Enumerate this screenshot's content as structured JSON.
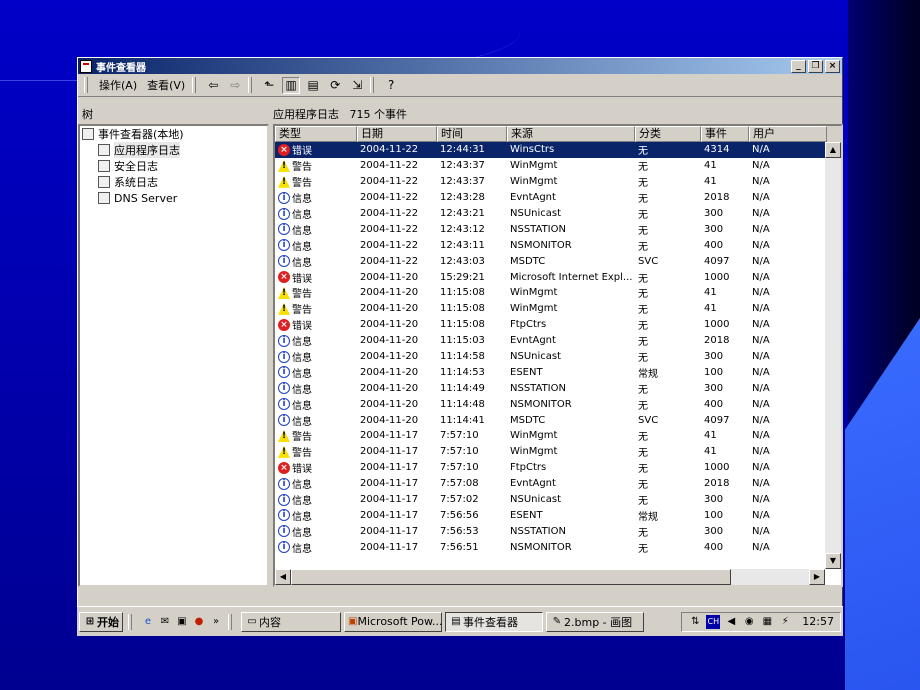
{
  "window": {
    "title": "事件查看器"
  },
  "menu": {
    "action": "操作(A)",
    "view": "查看(V)"
  },
  "tree": {
    "header": "树",
    "root": "事件查看器(本地)",
    "items": [
      "应用程序日志",
      "安全日志",
      "系统日志",
      "DNS Server"
    ]
  },
  "list": {
    "title": "应用程序日志",
    "count": "715 个事件",
    "columns": [
      "类型",
      "日期",
      "时间",
      "来源",
      "分类",
      "事件",
      "用户"
    ],
    "rows": [
      {
        "type": "错误",
        "level": "error",
        "date": "2004-11-22",
        "time": "12:44:31",
        "source": "WinsCtrs",
        "category": "无",
        "event": "4314",
        "user": "N/A"
      },
      {
        "type": "警告",
        "level": "warning",
        "date": "2004-11-22",
        "time": "12:43:37",
        "source": "WinMgmt",
        "category": "无",
        "event": "41",
        "user": "N/A"
      },
      {
        "type": "警告",
        "level": "warning",
        "date": "2004-11-22",
        "time": "12:43:37",
        "source": "WinMgmt",
        "category": "无",
        "event": "41",
        "user": "N/A"
      },
      {
        "type": "信息",
        "level": "info",
        "date": "2004-11-22",
        "time": "12:43:28",
        "source": "EvntAgnt",
        "category": "无",
        "event": "2018",
        "user": "N/A"
      },
      {
        "type": "信息",
        "level": "info",
        "date": "2004-11-22",
        "time": "12:43:21",
        "source": "NSUnicast",
        "category": "无",
        "event": "300",
        "user": "N/A"
      },
      {
        "type": "信息",
        "level": "info",
        "date": "2004-11-22",
        "time": "12:43:12",
        "source": "NSSTATION",
        "category": "无",
        "event": "300",
        "user": "N/A"
      },
      {
        "type": "信息",
        "level": "info",
        "date": "2004-11-22",
        "time": "12:43:11",
        "source": "NSMONITOR",
        "category": "无",
        "event": "400",
        "user": "N/A"
      },
      {
        "type": "信息",
        "level": "info",
        "date": "2004-11-22",
        "time": "12:43:03",
        "source": "MSDTC",
        "category": "SVC",
        "event": "4097",
        "user": "N/A"
      },
      {
        "type": "错误",
        "level": "error",
        "date": "2004-11-20",
        "time": "15:29:21",
        "source": "Microsoft Internet Expl...",
        "category": "无",
        "event": "1000",
        "user": "N/A"
      },
      {
        "type": "警告",
        "level": "warning",
        "date": "2004-11-20",
        "time": "11:15:08",
        "source": "WinMgmt",
        "category": "无",
        "event": "41",
        "user": "N/A"
      },
      {
        "type": "警告",
        "level": "warning",
        "date": "2004-11-20",
        "time": "11:15:08",
        "source": "WinMgmt",
        "category": "无",
        "event": "41",
        "user": "N/A"
      },
      {
        "type": "错误",
        "level": "error",
        "date": "2004-11-20",
        "time": "11:15:08",
        "source": "FtpCtrs",
        "category": "无",
        "event": "1000",
        "user": "N/A"
      },
      {
        "type": "信息",
        "level": "info",
        "date": "2004-11-20",
        "time": "11:15:03",
        "source": "EvntAgnt",
        "category": "无",
        "event": "2018",
        "user": "N/A"
      },
      {
        "type": "信息",
        "level": "info",
        "date": "2004-11-20",
        "time": "11:14:58",
        "source": "NSUnicast",
        "category": "无",
        "event": "300",
        "user": "N/A"
      },
      {
        "type": "信息",
        "level": "info",
        "date": "2004-11-20",
        "time": "11:14:53",
        "source": "ESENT",
        "category": "常规",
        "event": "100",
        "user": "N/A"
      },
      {
        "type": "信息",
        "level": "info",
        "date": "2004-11-20",
        "time": "11:14:49",
        "source": "NSSTATION",
        "category": "无",
        "event": "300",
        "user": "N/A"
      },
      {
        "type": "信息",
        "level": "info",
        "date": "2004-11-20",
        "time": "11:14:48",
        "source": "NSMONITOR",
        "category": "无",
        "event": "400",
        "user": "N/A"
      },
      {
        "type": "信息",
        "level": "info",
        "date": "2004-11-20",
        "time": "11:14:41",
        "source": "MSDTC",
        "category": "SVC",
        "event": "4097",
        "user": "N/A"
      },
      {
        "type": "警告",
        "level": "warning",
        "date": "2004-11-17",
        "time": "7:57:10",
        "source": "WinMgmt",
        "category": "无",
        "event": "41",
        "user": "N/A"
      },
      {
        "type": "警告",
        "level": "warning",
        "date": "2004-11-17",
        "time": "7:57:10",
        "source": "WinMgmt",
        "category": "无",
        "event": "41",
        "user": "N/A"
      },
      {
        "type": "错误",
        "level": "error",
        "date": "2004-11-17",
        "time": "7:57:10",
        "source": "FtpCtrs",
        "category": "无",
        "event": "1000",
        "user": "N/A"
      },
      {
        "type": "信息",
        "level": "info",
        "date": "2004-11-17",
        "time": "7:57:08",
        "source": "EvntAgnt",
        "category": "无",
        "event": "2018",
        "user": "N/A"
      },
      {
        "type": "信息",
        "level": "info",
        "date": "2004-11-17",
        "time": "7:57:02",
        "source": "NSUnicast",
        "category": "无",
        "event": "300",
        "user": "N/A"
      },
      {
        "type": "信息",
        "level": "info",
        "date": "2004-11-17",
        "time": "7:56:56",
        "source": "ESENT",
        "category": "常规",
        "event": "100",
        "user": "N/A"
      },
      {
        "type": "信息",
        "level": "info",
        "date": "2004-11-17",
        "time": "7:56:53",
        "source": "NSSTATION",
        "category": "无",
        "event": "300",
        "user": "N/A"
      },
      {
        "type": "信息",
        "level": "info",
        "date": "2004-11-17",
        "time": "7:56:51",
        "source": "NSMONITOR",
        "category": "无",
        "event": "400",
        "user": "N/A"
      }
    ]
  },
  "taskbar": {
    "start": "开始",
    "chevron": "»",
    "tasks": [
      "内容",
      "Microsoft Pow...",
      "事件查看器",
      "2.bmp - 画图"
    ],
    "clock": "12:57",
    "tray_lang": "CH"
  },
  "colors": {
    "selection": "#0a246a",
    "error": "#e02020",
    "warning": "#f8e000",
    "info": "#2040c0"
  }
}
